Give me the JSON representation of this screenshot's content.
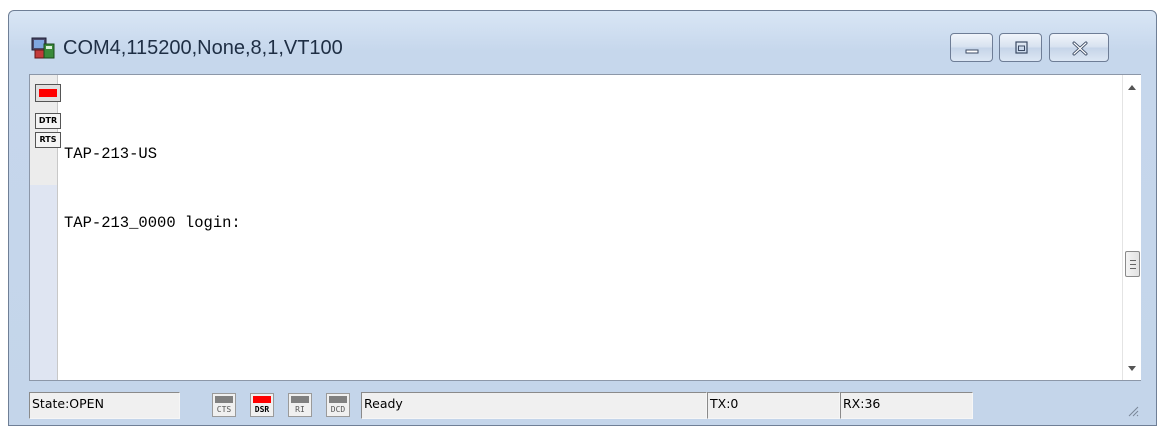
{
  "window": {
    "title": "COM4,115200,None,8,1,VT100",
    "app_icon": "terminal-app-icon",
    "controls": {
      "minimize": "minimize-icon",
      "maximize": "maximize-icon",
      "close": "close-icon"
    }
  },
  "leftbar": {
    "led_color": "#ff0000",
    "buttons": [
      {
        "label": "DTR"
      },
      {
        "label": "RTS"
      }
    ]
  },
  "terminal": {
    "lines": [
      "TAP-213-US",
      "TAP-213_0000 login:"
    ]
  },
  "statusbar": {
    "state": "State:OPEN",
    "signals": [
      {
        "label": "CTS",
        "color": "#808080"
      },
      {
        "label": "DSR",
        "color": "#ff0000"
      },
      {
        "label": "RI",
        "color": "#808080"
      },
      {
        "label": "DCD",
        "color": "#808080"
      }
    ],
    "status": "Ready",
    "tx": "TX:0",
    "rx": "RX:36"
  }
}
